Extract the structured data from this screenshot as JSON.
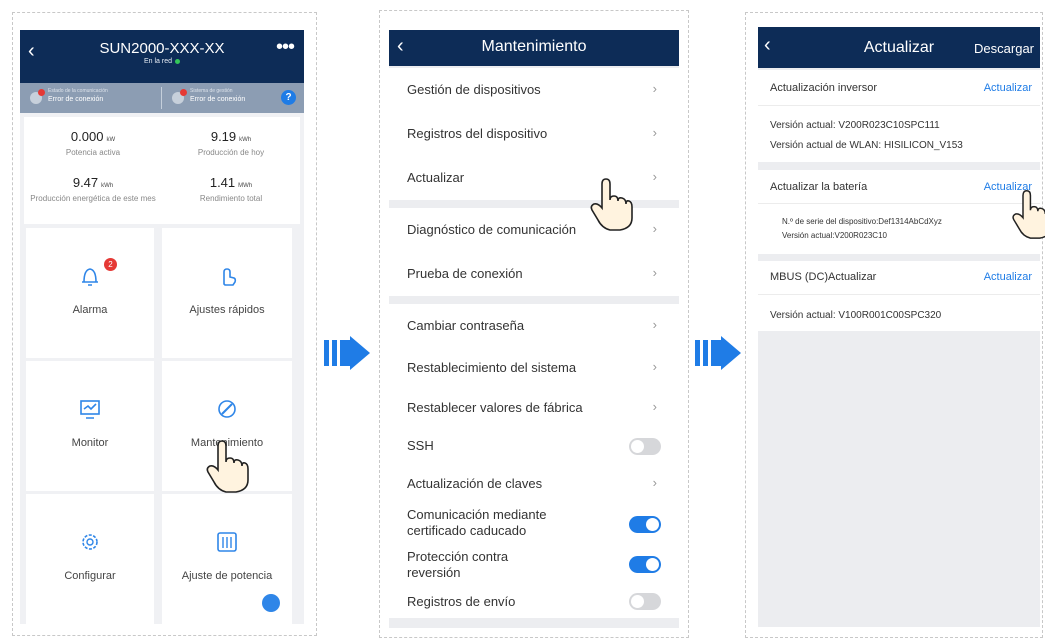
{
  "panel1": {
    "title": "SUN2000-XXX-XX",
    "status": "En la red",
    "comm": {
      "label": "Estado de la comunicación",
      "value": "Error de conexión"
    },
    "mgmt": {
      "label": "Sistema de gestión",
      "value": "Error de conexión"
    },
    "kpis": [
      {
        "value": "0.000",
        "unit": "kW",
        "label": "Potencia activa"
      },
      {
        "value": "9.19",
        "unit": "kWh",
        "label": "Producción de hoy"
      },
      {
        "value": "9.47",
        "unit": "kWh",
        "label": "Producción energética de este mes"
      },
      {
        "value": "1.41",
        "unit": "MWh",
        "label": "Rendimiento total"
      }
    ],
    "tiles": [
      {
        "label": "Alarma",
        "badge": "2"
      },
      {
        "label": "Ajustes rápidos"
      },
      {
        "label": "Monitor"
      },
      {
        "label": "Mantenimiento"
      },
      {
        "label": "Configurar"
      },
      {
        "label": "Ajuste de potencia"
      }
    ]
  },
  "panel2": {
    "title": "Mantenimiento",
    "items": [
      {
        "label": "Gestión de dispositivos"
      },
      {
        "label": "Registros del dispositivo"
      },
      {
        "label": "Actualizar"
      },
      {
        "label": "Diagnóstico de comunicación"
      },
      {
        "label": "Prueba de conexión"
      },
      {
        "label": "Cambiar contraseña"
      },
      {
        "label": "Restablecimiento del sistema"
      },
      {
        "label": "Restablecer valores de fábrica"
      },
      {
        "label": "SSH",
        "toggle": "off"
      },
      {
        "label": "Actualización de claves"
      },
      {
        "label": "Comunicación mediante certificado caducado",
        "toggle": "on"
      },
      {
        "label": "Protección contra reversión",
        "toggle": "on"
      },
      {
        "label": "Registros de envío",
        "toggle": "off"
      }
    ]
  },
  "panel3": {
    "title": "Actualizar",
    "download": "Descargar",
    "sections": [
      {
        "title": "Actualización inversor",
        "action": "Actualizar",
        "lines": [
          "Versión actual: V200R023C10SPC111",
          "Versión actual de WLAN: HISILICON_V153"
        ]
      },
      {
        "title": "Actualizar la batería",
        "action": "Actualizar",
        "lines": [
          "N.º de serie del dispositivo:Def1314AbCdXyz",
          "Versión actual:V200R023C10"
        ]
      },
      {
        "title": "MBUS (DC)Actualizar",
        "action": "Actualizar",
        "lines": [
          "Versión actual: V100R001C00SPC320"
        ]
      }
    ]
  },
  "colors": {
    "header": "#0d2c57",
    "accent": "#1f7ce6",
    "arrow": "#1f7ce6",
    "alert": "#e53935"
  }
}
